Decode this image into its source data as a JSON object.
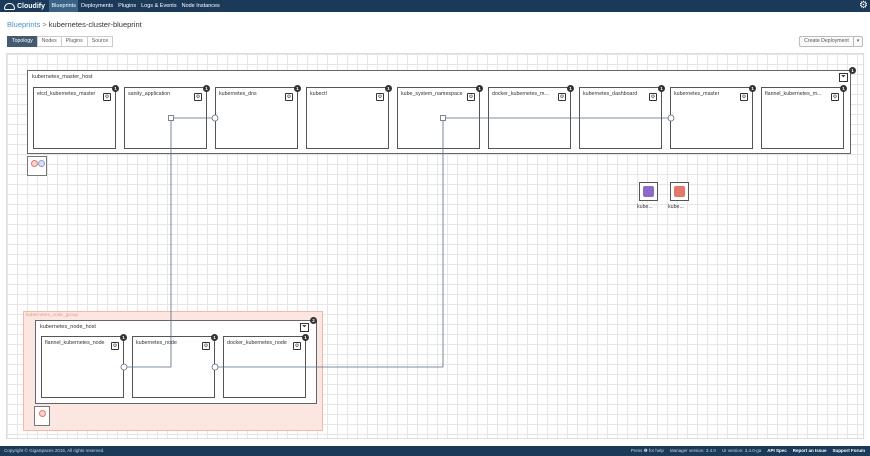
{
  "app": {
    "name": "Cloudify"
  },
  "nav": [
    "Blueprints",
    "Deployments",
    "Plugins",
    "Logs & Events",
    "Node Instances"
  ],
  "breadcrumb": {
    "parent": "Blueprints",
    "separator": ">",
    "current": "kubernetes-cluster-blueprint"
  },
  "tabs": [
    "Topology",
    "Nodes",
    "Plugins",
    "Source"
  ],
  "create_button": "Create Deployment",
  "master_host": {
    "title": "kubernetes_master_host",
    "count": "1",
    "nodes": [
      {
        "name": "etcd_kubernetes_master",
        "count": "1"
      },
      {
        "name": "sanity_application",
        "count": "1"
      },
      {
        "name": "kubernetes_dns",
        "count": "1"
      },
      {
        "name": "kubectl",
        "count": "1"
      },
      {
        "name": "kube_system_namespace",
        "count": "1"
      },
      {
        "name": "docker_kubernetes_m...",
        "count": "1"
      },
      {
        "name": "kubernetes_dashboard",
        "count": "1"
      },
      {
        "name": "kubernetes_master",
        "count": "1"
      },
      {
        "name": "flannel_kubernetes_m...",
        "count": "1"
      }
    ]
  },
  "side_nodes": [
    {
      "label": "kube...",
      "color": "#8c6bc8",
      "icon": "network-icon"
    },
    {
      "label": "kube...",
      "color": "#e5766a",
      "icon": "lock-icon"
    }
  ],
  "scaling_group": {
    "label": "kubernetes_node_group",
    "host": {
      "title": "kubernetes_node_host",
      "count": "2",
      "nodes": [
        {
          "name": "flannel_kubernetes_node",
          "count": "1"
        },
        {
          "name": "kubernetes_node",
          "count": "1"
        },
        {
          "name": "docker_kubernetes_node",
          "count": "1"
        }
      ]
    }
  },
  "footer": {
    "copyright": "Copyright © GigaSpaces 2016, All rights reserved.",
    "help": "Press ❶ for help",
    "manager_version": "Manager version: 3.4.0",
    "ui_version": "UI version: 3.4.0-ga",
    "links": [
      "API Spec",
      "Report an Issue",
      "Support Forum"
    ]
  },
  "colors": {
    "topbar": "#1b3a5a",
    "active_tab": "#435a70",
    "scaling_group": "#fbe6e1"
  }
}
